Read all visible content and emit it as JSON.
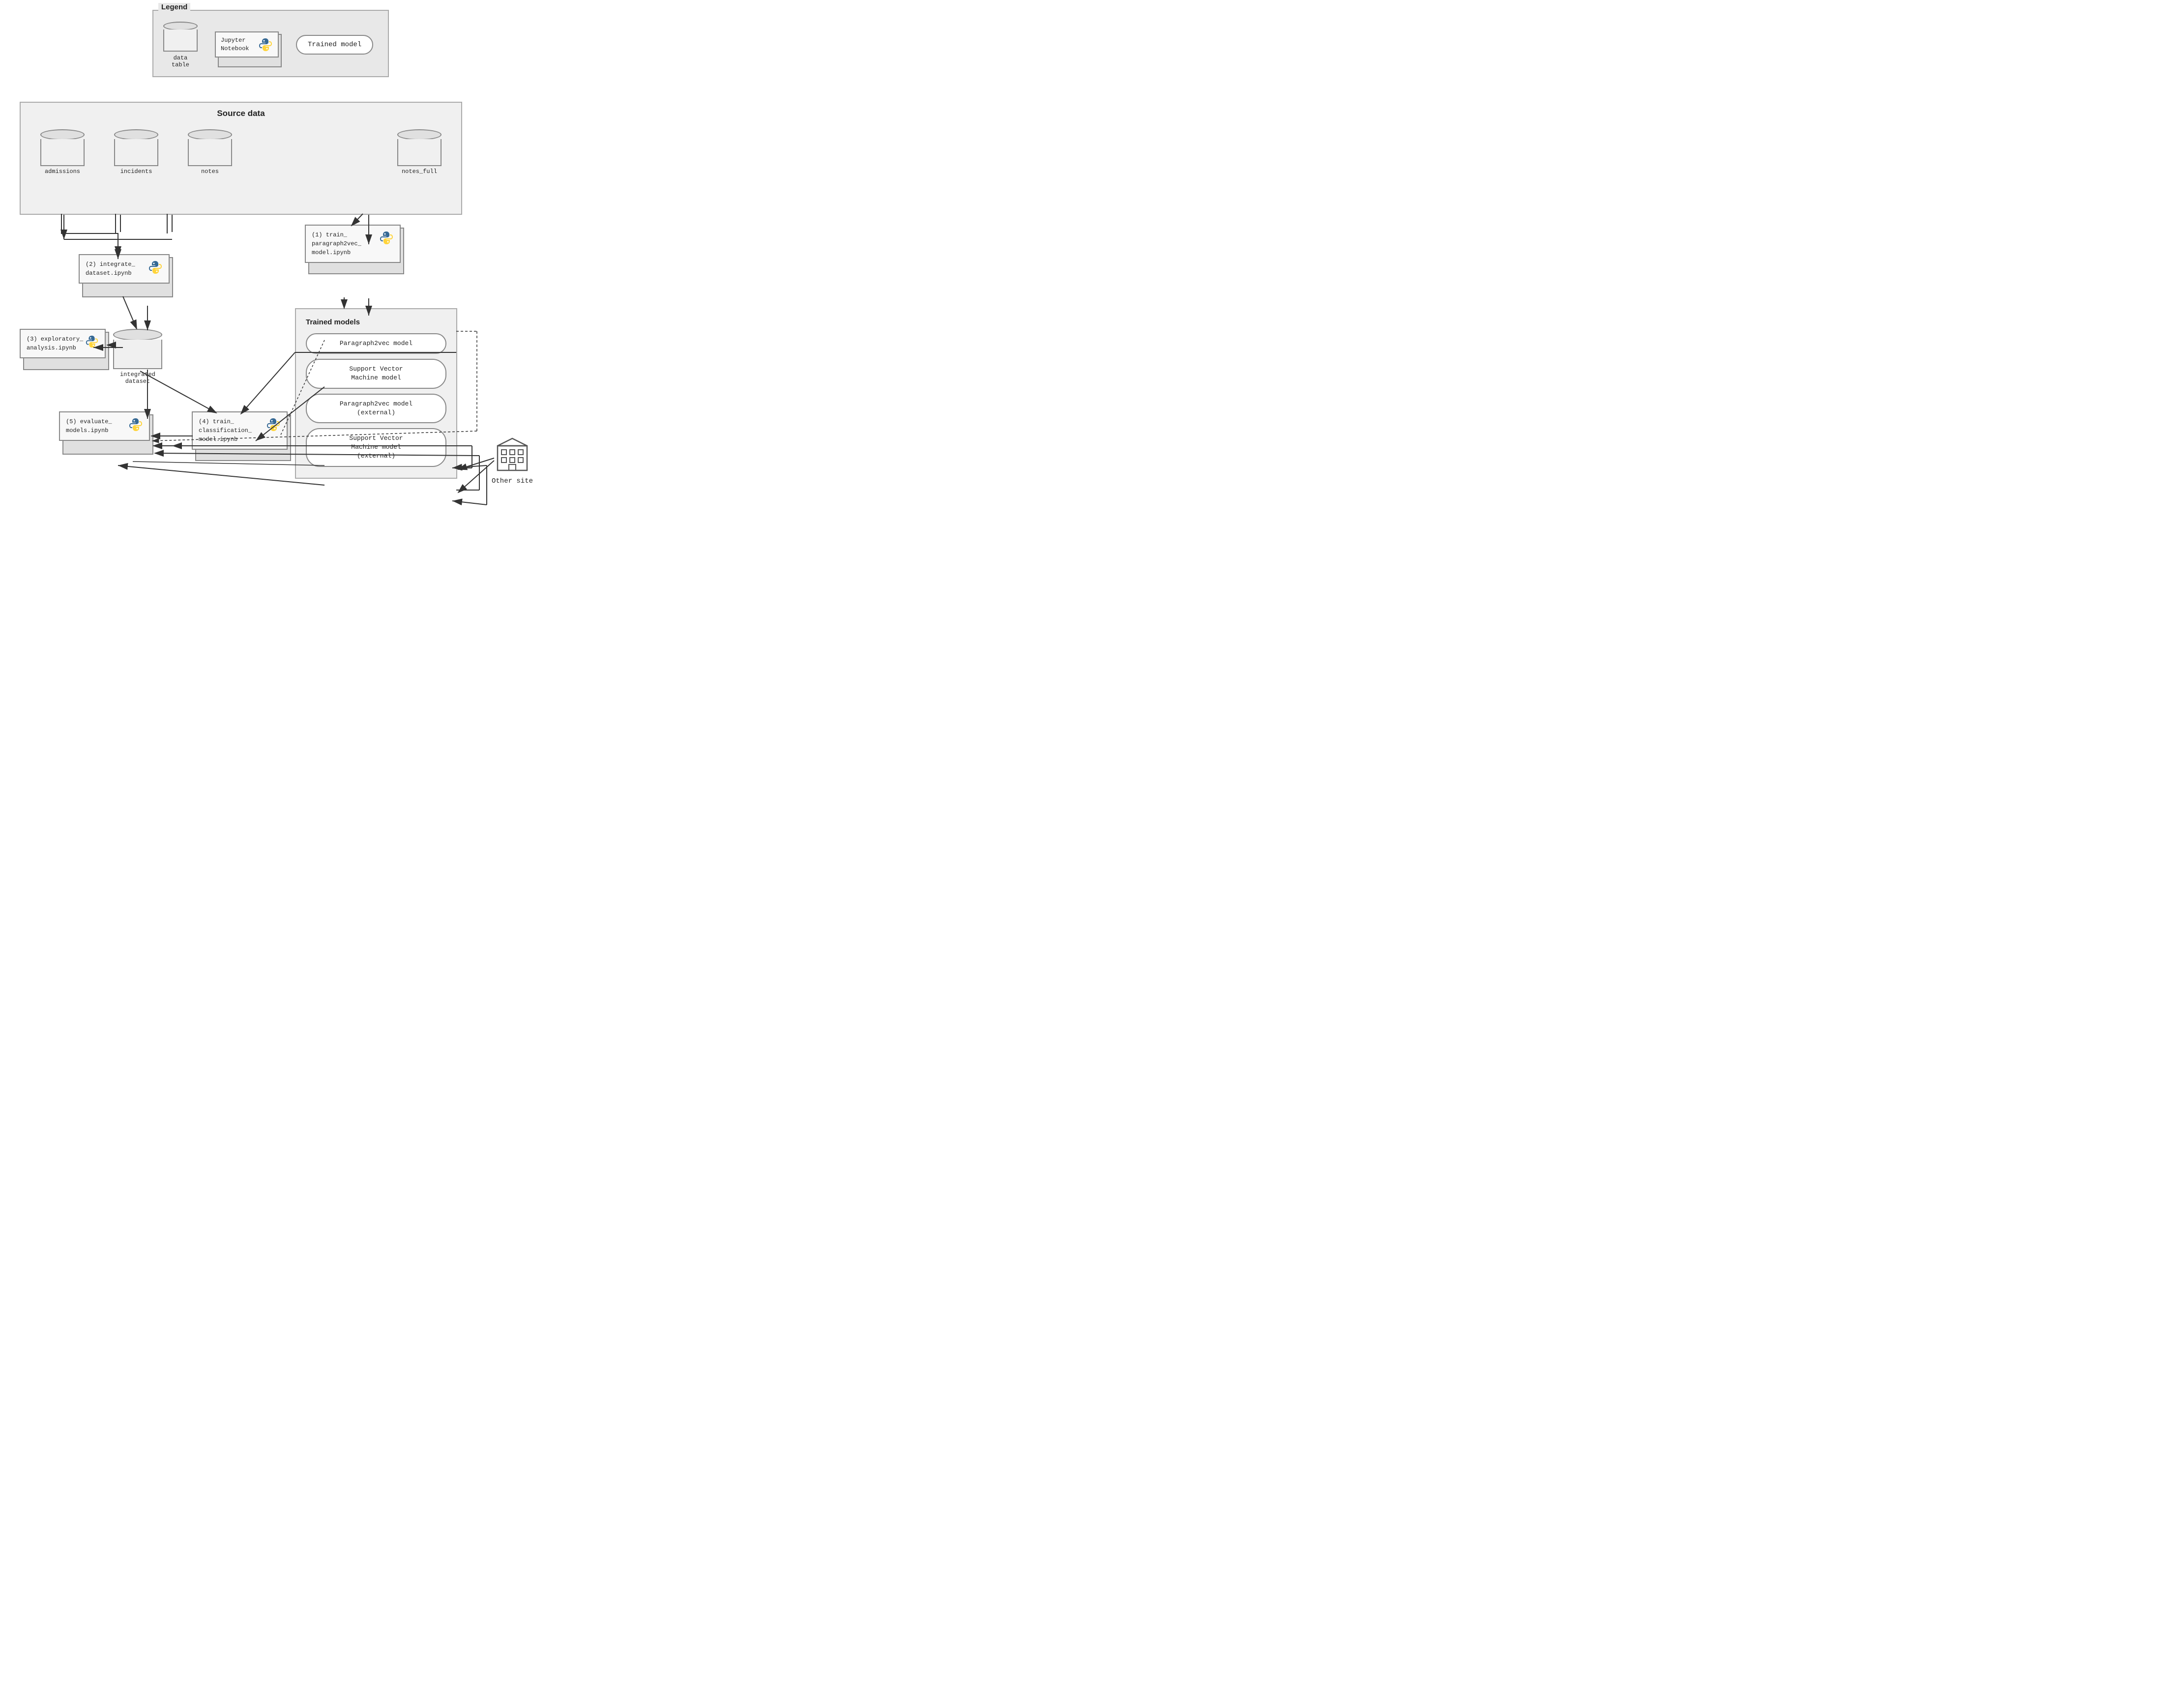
{
  "legend": {
    "title": "Legend",
    "items": [
      {
        "type": "datatable",
        "label": "data\ntable"
      },
      {
        "type": "notebook",
        "label": "Jupyter\nNotebook"
      },
      {
        "type": "model",
        "label": "Trained model"
      }
    ]
  },
  "sourceData": {
    "title": "Source data",
    "tables": [
      {
        "label": "admissions"
      },
      {
        "label": "incidents"
      },
      {
        "label": "notes"
      },
      {
        "label": "notes_full"
      }
    ]
  },
  "notebooks": [
    {
      "id": "nb1",
      "label": "(1) train_\nparagraph2vec_\nmodel.ipynb"
    },
    {
      "id": "nb2",
      "label": "(2) integrate_\ndataset.ipynb"
    },
    {
      "id": "nb3",
      "label": "(3) exploratory_\nanalysis.ipynb"
    },
    {
      "id": "nb4",
      "label": "(4) train_\nclassification_\nmodel.ipynb"
    },
    {
      "id": "nb5",
      "label": "(5) evaluate_\nmodels.ipynb"
    }
  ],
  "trainedModels": {
    "title": "Trained models",
    "models": [
      {
        "label": "Paragraph2vec model"
      },
      {
        "label": "Support Vector\nMachine model"
      },
      {
        "label": "Paragraph2vec model\n(external)"
      },
      {
        "label": "Support Vector\nMachine model\n(external)"
      }
    ]
  },
  "integratedDataset": {
    "label": "integrated\ndataset"
  },
  "otherSite": {
    "label": "Other site"
  }
}
